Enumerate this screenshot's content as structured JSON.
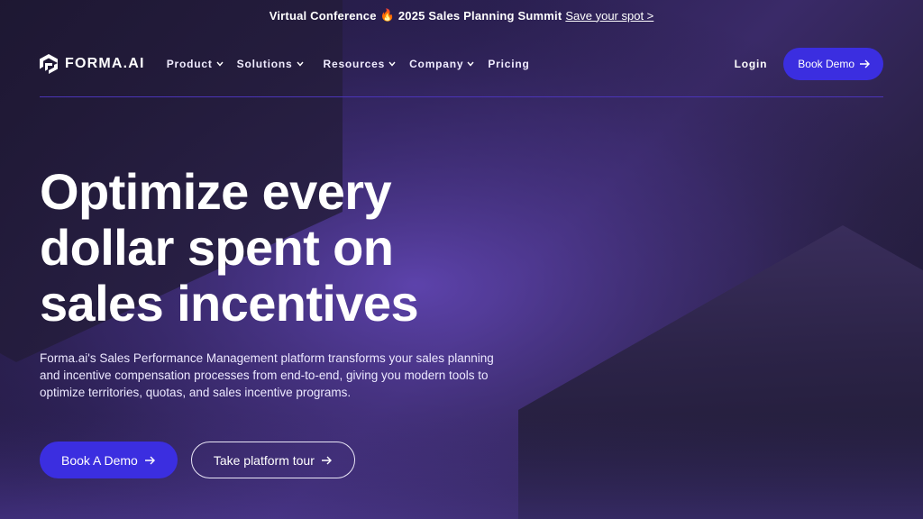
{
  "announcement": {
    "text_before": "Virtual Conference",
    "fire_glyph": "🔥",
    "text_after": "2025 Sales Planning Summit",
    "cta": "Save your spot >"
  },
  "brand": {
    "name": "FORMA.AI",
    "logo_icon": "forma-logo-icon",
    "accent": "#3b2ee0"
  },
  "nav": {
    "items": [
      {
        "label": "Product",
        "dropdown": true
      },
      {
        "label": "Solutions",
        "dropdown": true
      },
      {
        "label": "Resources",
        "dropdown": true
      },
      {
        "label": "Company",
        "dropdown": true
      },
      {
        "label": "Pricing",
        "dropdown": false
      }
    ],
    "login": "Login",
    "book_demo": "Book Demo"
  },
  "hero": {
    "headline": "Optimize every dollar spent on sales incentives",
    "description": "Forma.ai's Sales Performance Management platform transforms your sales planning and incentive compensation processes from end-to-end, giving you modern tools to optimize territories, quotas, and sales incentive programs.",
    "primary_cta": "Book A Demo",
    "secondary_cta": "Take platform tour"
  }
}
